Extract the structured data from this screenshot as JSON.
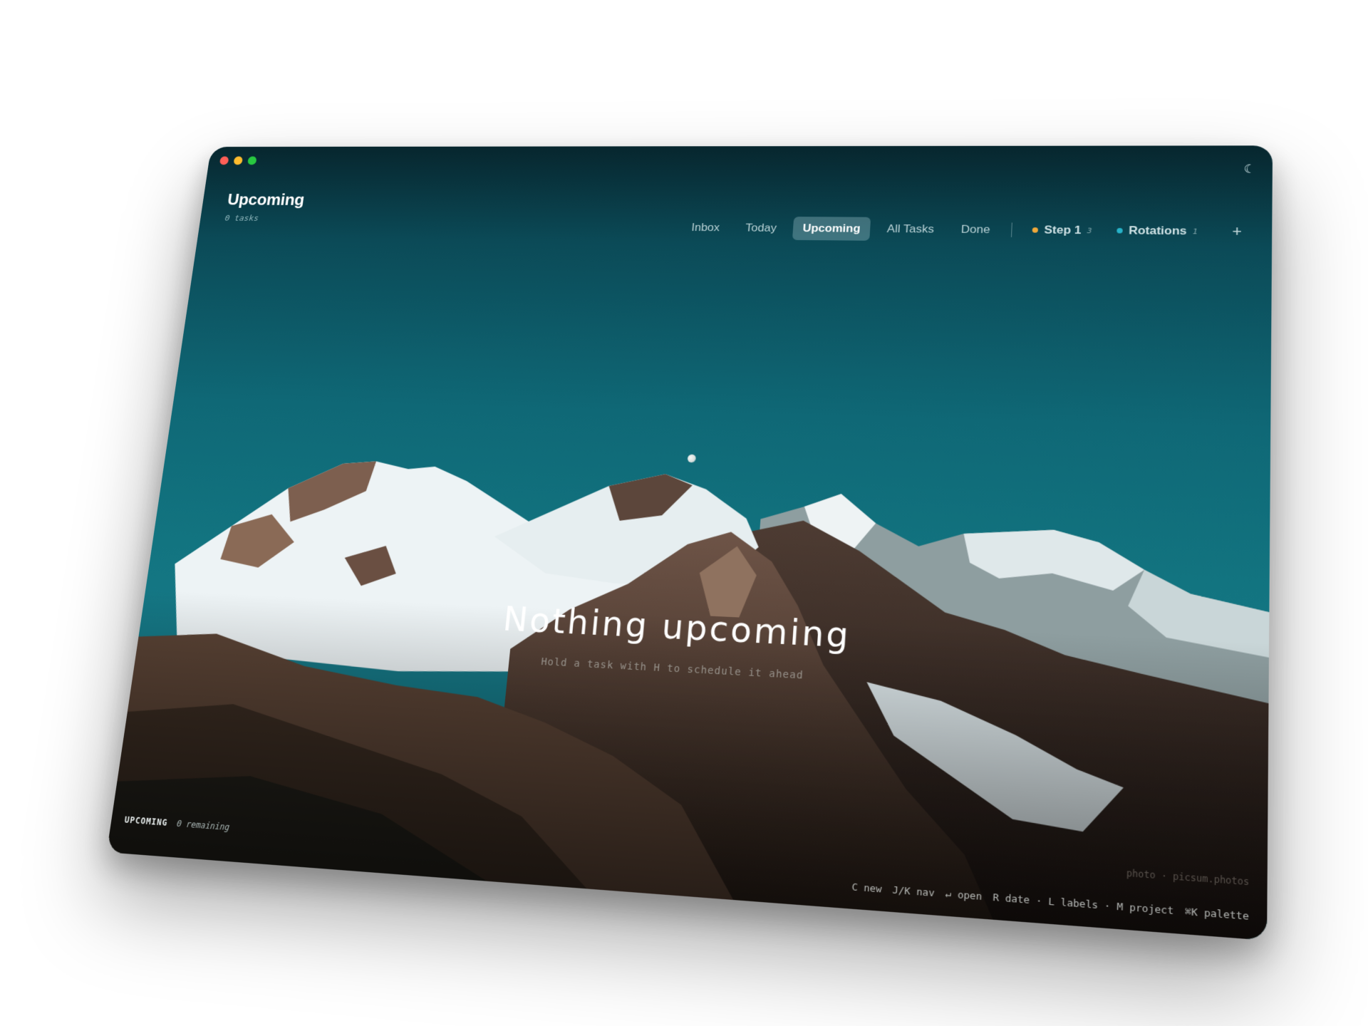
{
  "window": {
    "controls": [
      "close",
      "minimize",
      "maximize"
    ],
    "theme_icon": "moon-icon"
  },
  "header": {
    "title": "Upcoming",
    "count": "0 tasks"
  },
  "nav": {
    "items": [
      {
        "label": "Inbox",
        "active": false
      },
      {
        "label": "Today",
        "active": false
      },
      {
        "label": "Upcoming",
        "active": true
      },
      {
        "label": "All Tasks",
        "active": false
      },
      {
        "label": "Done",
        "active": false
      }
    ],
    "projects": [
      {
        "label": "Step 1",
        "count": "3",
        "color": "#f0a93b"
      },
      {
        "label": "Rotations",
        "count": "1",
        "color": "#27b3c9"
      }
    ],
    "add_label": "+"
  },
  "empty_state": {
    "title": "Nothing upcoming",
    "hint": "Hold a task with H to schedule it ahead"
  },
  "status_bar": {
    "view": "UPCOMING",
    "remaining": "0 remaining",
    "shortcuts": [
      "C new",
      "J/K nav",
      "↵ open",
      "R date · L labels · M project",
      "⌘K palette"
    ],
    "photo_credit": "photo · picsum.photos"
  }
}
